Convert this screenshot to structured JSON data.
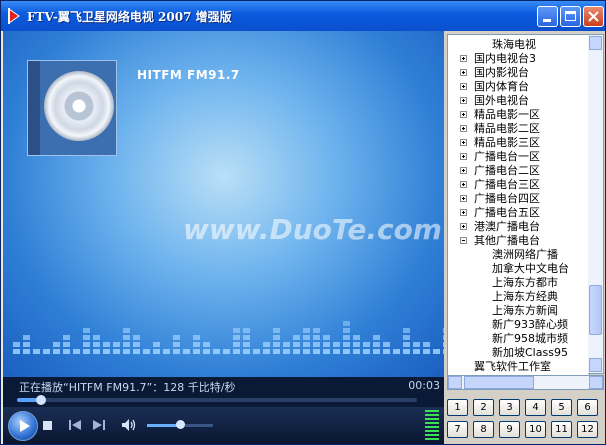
{
  "window": {
    "title": "FTV-翼飞卫星网络电视 2007 增强版"
  },
  "now_playing": {
    "title": "HITFM FM91.7"
  },
  "watermark": "www.DuoTe.com",
  "status": {
    "message": "正在播放“HITFM FM91.7”：128 千比特/秒",
    "time": "00:03"
  },
  "seek": {
    "progress": 0.06
  },
  "volume": {
    "level": 0.5
  },
  "channel_tree": {
    "items": [
      {
        "label": "珠海电视",
        "level": 1,
        "expander": ""
      },
      {
        "label": "国内电视台3",
        "level": 0,
        "expander": "plus"
      },
      {
        "label": "国内影视台",
        "level": 0,
        "expander": "plus"
      },
      {
        "label": "国内体育台",
        "level": 0,
        "expander": "plus"
      },
      {
        "label": "国外电视台",
        "level": 0,
        "expander": "plus"
      },
      {
        "label": "精品电影一区",
        "level": 0,
        "expander": "plus"
      },
      {
        "label": "精品电影二区",
        "level": 0,
        "expander": "plus"
      },
      {
        "label": "精品电影三区",
        "level": 0,
        "expander": "plus"
      },
      {
        "label": "广播电台一区",
        "level": 0,
        "expander": "plus"
      },
      {
        "label": "广播电台二区",
        "level": 0,
        "expander": "plus"
      },
      {
        "label": "广播电台三区",
        "level": 0,
        "expander": "plus"
      },
      {
        "label": "广播电台四区",
        "level": 0,
        "expander": "plus"
      },
      {
        "label": "广播电台五区",
        "level": 0,
        "expander": "plus"
      },
      {
        "label": "港澳广播电台",
        "level": 0,
        "expander": "plus"
      },
      {
        "label": "其他广播电台",
        "level": 0,
        "expander": "minus"
      },
      {
        "label": "澳洲网络广播",
        "level": 1,
        "expander": ""
      },
      {
        "label": "加拿大中文电台",
        "level": 1,
        "expander": ""
      },
      {
        "label": "上海东方都市",
        "level": 1,
        "expander": ""
      },
      {
        "label": "上海东方经典",
        "level": 1,
        "expander": ""
      },
      {
        "label": "上海东方新闻",
        "level": 1,
        "expander": ""
      },
      {
        "label": "新广933醉心频",
        "level": 1,
        "expander": ""
      },
      {
        "label": "新广958城市频",
        "level": 1,
        "expander": ""
      },
      {
        "label": "新加坡Class95",
        "level": 1,
        "expander": ""
      },
      {
        "label": "翼飞软件工作室",
        "level": 0,
        "expander": ""
      }
    ]
  },
  "numpad": [
    "1",
    "2",
    "3",
    "4",
    "5",
    "6",
    "7",
    "8",
    "9",
    "10",
    "11",
    "12"
  ],
  "icons": {
    "app": "app-logo-icon",
    "minimize": "minimize-icon",
    "maximize": "maximize-icon",
    "close": "close-icon",
    "play": "play-icon",
    "stop": "stop-icon",
    "prev": "previous-track-icon",
    "next": "next-track-icon",
    "volume": "speaker-icon",
    "eq": "equalizer-icon"
  }
}
